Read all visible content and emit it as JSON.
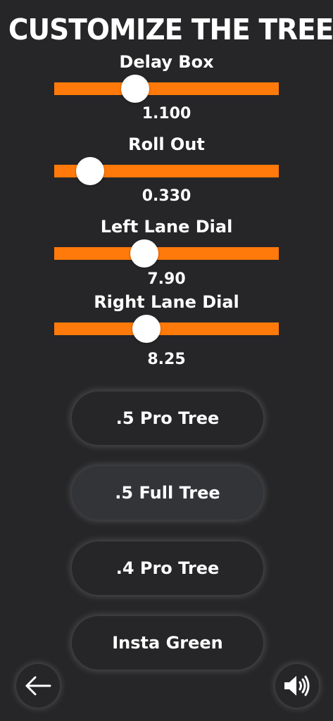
{
  "header": {
    "title": "CUSTOMIZE THE TREE"
  },
  "sliders": [
    {
      "label": "Delay Box",
      "value_text": "1.100",
      "position": 0.36
    },
    {
      "label": "Roll Out",
      "value_text": "0.330",
      "position": 0.16
    },
    {
      "label": "Left Lane Dial",
      "value_text": "7.90",
      "position": 0.4
    },
    {
      "label": "Right Lane Dial",
      "value_text": "8.25",
      "position": 0.41
    }
  ],
  "presets": [
    {
      "label": ".5 Pro Tree",
      "selected": false
    },
    {
      "label": ".5 Full Tree",
      "selected": true
    },
    {
      "label": ".4 Pro Tree",
      "selected": false
    },
    {
      "label": "Insta Green",
      "selected": false
    }
  ],
  "footer": {
    "back_icon": "arrow-left-icon",
    "sound_icon": "speaker-volume-icon"
  },
  "colors": {
    "background": "#262628",
    "accent": "#ff7a0a",
    "thumb": "#ffffff",
    "selected_button": "#323438"
  }
}
